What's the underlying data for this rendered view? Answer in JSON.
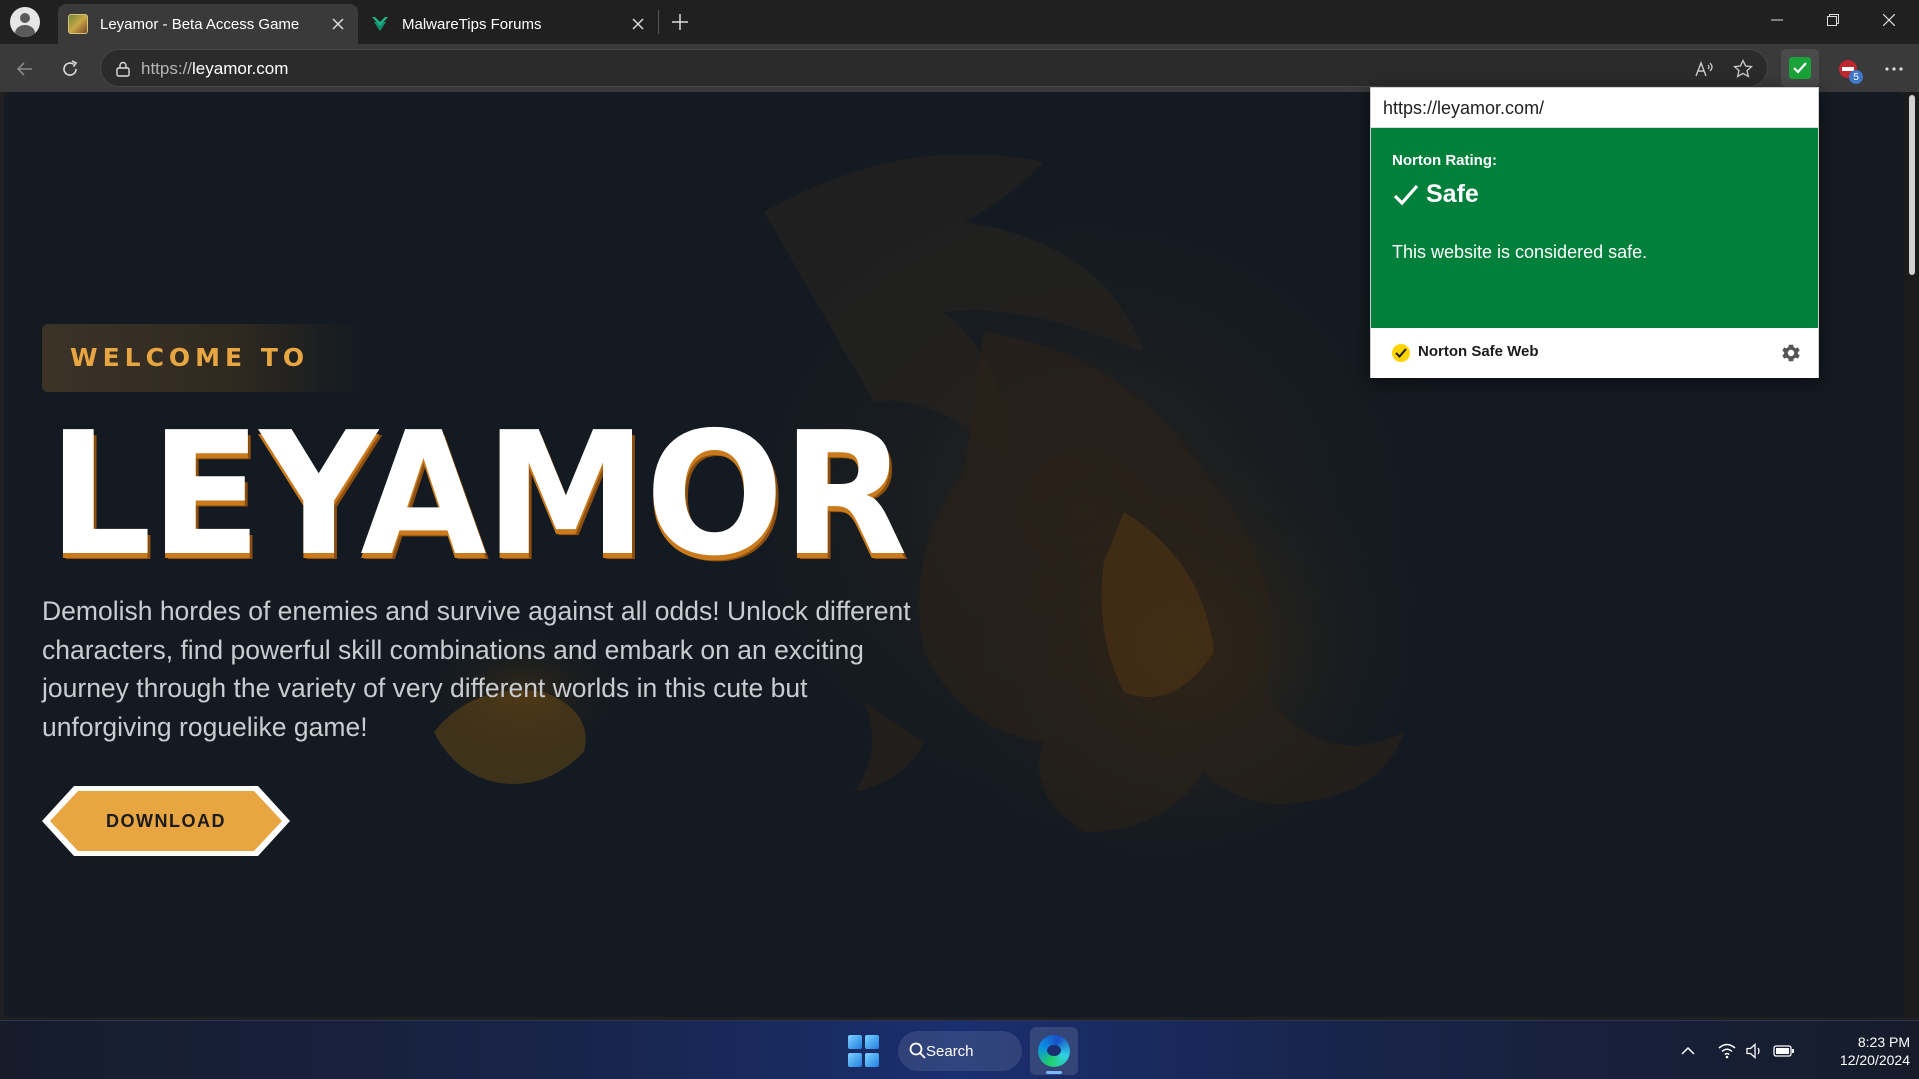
{
  "browser": {
    "tabs": [
      {
        "title": "Leyamor - Beta Access Game",
        "active": true,
        "favicon": "game-favicon"
      },
      {
        "title": "MalwareTips Forums",
        "active": false,
        "favicon": "malwaretips-favicon"
      }
    ],
    "new_tab_icon": "plus-icon",
    "address": {
      "scheme": "https://",
      "host": "leyamor.com"
    },
    "extensions": {
      "ublock_badge": "5"
    }
  },
  "page": {
    "welcome": "WELCOME TO",
    "logo": "LEYAMOR",
    "description": "Demolish hordes of enemies and survive against all odds! Unlock different characters, find powerful skill combinations and embark on an exciting journey through the variety of very different worlds in this cute but unforgiving roguelike game!",
    "download_label": "DOWNLOAD",
    "colors": {
      "accent": "#e8a643",
      "background": "#131a21"
    }
  },
  "norton_popup": {
    "url": "https://leyamor.com/",
    "rating_label": "Norton Rating:",
    "rating_value": "Safe",
    "message": "This website is considered safe.",
    "brand": "Norton Safe Web",
    "colors": {
      "safe_green": "#00803b"
    }
  },
  "taskbar": {
    "search_label": "Search",
    "time": "8:23 PM",
    "date": "12/20/2024"
  }
}
